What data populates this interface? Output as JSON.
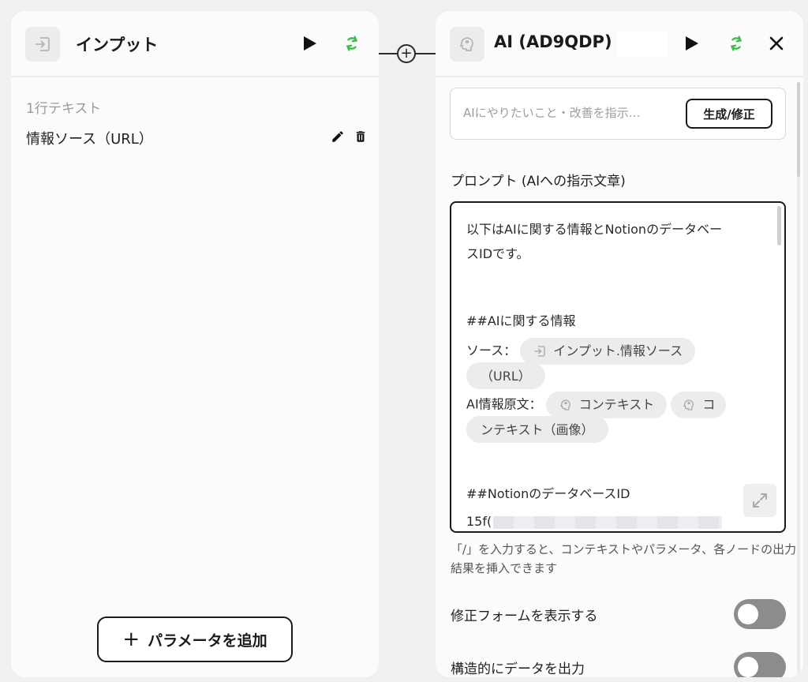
{
  "left_panel": {
    "title": "インプット",
    "section_label": "1行テキスト",
    "params": [
      {
        "name": "情報ソース（URL）"
      }
    ],
    "add_button_label": "パラメータを追加"
  },
  "right_panel": {
    "title": "AI (AD9QDP)",
    "instruct_placeholder": "AIにやりたいこと・改善を指示…",
    "generate_button_label": "生成/修正",
    "prompt_label": "プロンプト (AIへの指示文章)",
    "prompt": {
      "line1": "以下はAIに関する情報とNotionのデータベー",
      "line2": "スIDです。",
      "heading1": "##AIに関する情報",
      "source_label": "ソース：",
      "source_chip_a": "インプット.情報ソース",
      "source_chip_b": "（URL）",
      "original_label": "AI情報原文：",
      "context_chip": "コンテキスト",
      "context_image_chip_a": "コ",
      "context_image_chip_b": "ンテキスト（画像）",
      "heading2": "##NotionのデータベースID",
      "db_id_prefix": "15f("
    },
    "hint": "「/」を入力すると、コンテキストやパラメータ、各ノードの出力結果を挿入できます",
    "toggle1_label": "修正フォームを表示する",
    "toggle2_label": "構造的にデータを出力"
  },
  "colors": {
    "accent_green": "#3cbf4a",
    "toggle_off": "#8c8c8c",
    "border_dark": "#1a1a1a"
  },
  "icons": {
    "input_node": "login-arrow-icon",
    "ai_node": "ai-head-icon",
    "run": "play-icon",
    "refresh": "refresh-icon",
    "close": "close-icon",
    "edit": "pencil-icon",
    "delete": "trash-icon",
    "expand": "expand-icon"
  }
}
